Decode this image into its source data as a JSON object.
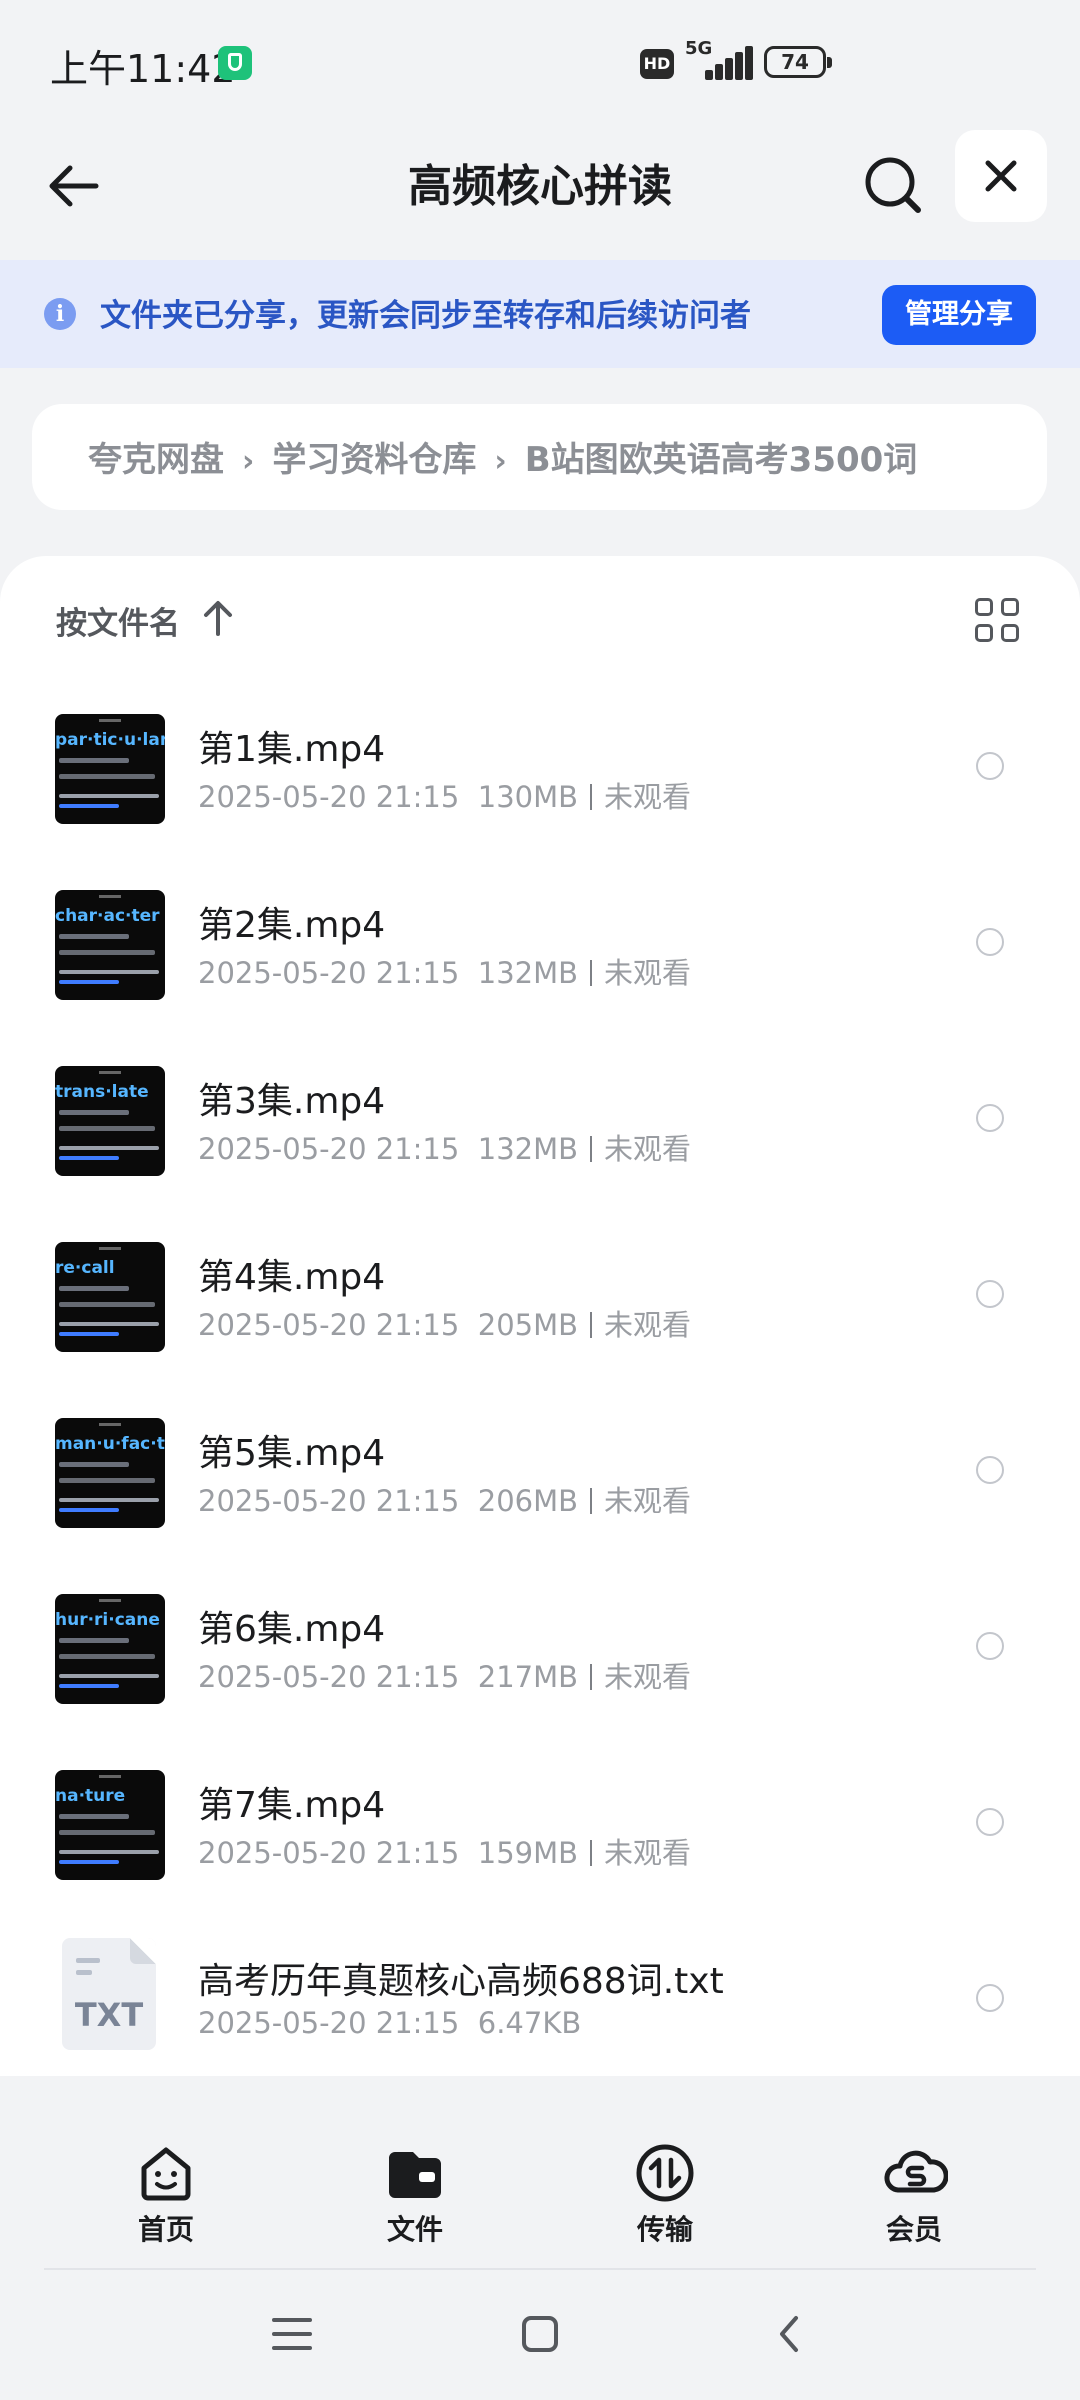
{
  "status_bar": {
    "time": "上午11:42",
    "hd_label": "HD",
    "network": "5G",
    "battery": "74"
  },
  "header": {
    "title": "高频核心拼读"
  },
  "banner": {
    "message": "文件夹已分享，更新会同步至转存和后续访问者",
    "button": "管理分享"
  },
  "breadcrumb": [
    "夸克网盘",
    "学习资料仓库",
    "B站图欧英语高考3500词"
  ],
  "sort": {
    "label": "按文件名"
  },
  "files": [
    {
      "name": "第1集.mp4",
      "date": "2025-05-20 21:15",
      "size": "130MB",
      "status": "未观看",
      "thumb_word": "par·tic·u·lar",
      "type": "video"
    },
    {
      "name": "第2集.mp4",
      "date": "2025-05-20 21:15",
      "size": "132MB",
      "status": "未观看",
      "thumb_word": "char·ac·ter",
      "type": "video"
    },
    {
      "name": "第3集.mp4",
      "date": "2025-05-20 21:15",
      "size": "132MB",
      "status": "未观看",
      "thumb_word": "trans·late",
      "type": "video"
    },
    {
      "name": "第4集.mp4",
      "date": "2025-05-20 21:15",
      "size": "205MB",
      "status": "未观看",
      "thumb_word": "re·call",
      "type": "video"
    },
    {
      "name": "第5集.mp4",
      "date": "2025-05-20 21:15",
      "size": "206MB",
      "status": "未观看",
      "thumb_word": "man·u·fac·ture",
      "type": "video"
    },
    {
      "name": "第6集.mp4",
      "date": "2025-05-20 21:15",
      "size": "217MB",
      "status": "未观看",
      "thumb_word": "hur·ri·cane",
      "type": "video"
    },
    {
      "name": "第7集.mp4",
      "date": "2025-05-20 21:15",
      "size": "159MB",
      "status": "未观看",
      "thumb_word": "na·ture",
      "type": "video"
    },
    {
      "name": "高考历年真题核心高频688词.txt",
      "date": "2025-05-20 21:15",
      "size": "6.47KB",
      "status": "",
      "thumb_word": "TXT",
      "type": "txt"
    }
  ],
  "bottom_nav": [
    {
      "label": "首页",
      "icon": "home-smile-icon"
    },
    {
      "label": "文件",
      "icon": "folder-icon",
      "active": true
    },
    {
      "label": "传输",
      "icon": "transfer-icon"
    },
    {
      "label": "会员",
      "icon": "vip-cloud-icon"
    }
  ],
  "colors": {
    "accent": "#1c5cf5",
    "banner_bg": "#e6ebfb",
    "banner_text": "#2a56c4"
  }
}
